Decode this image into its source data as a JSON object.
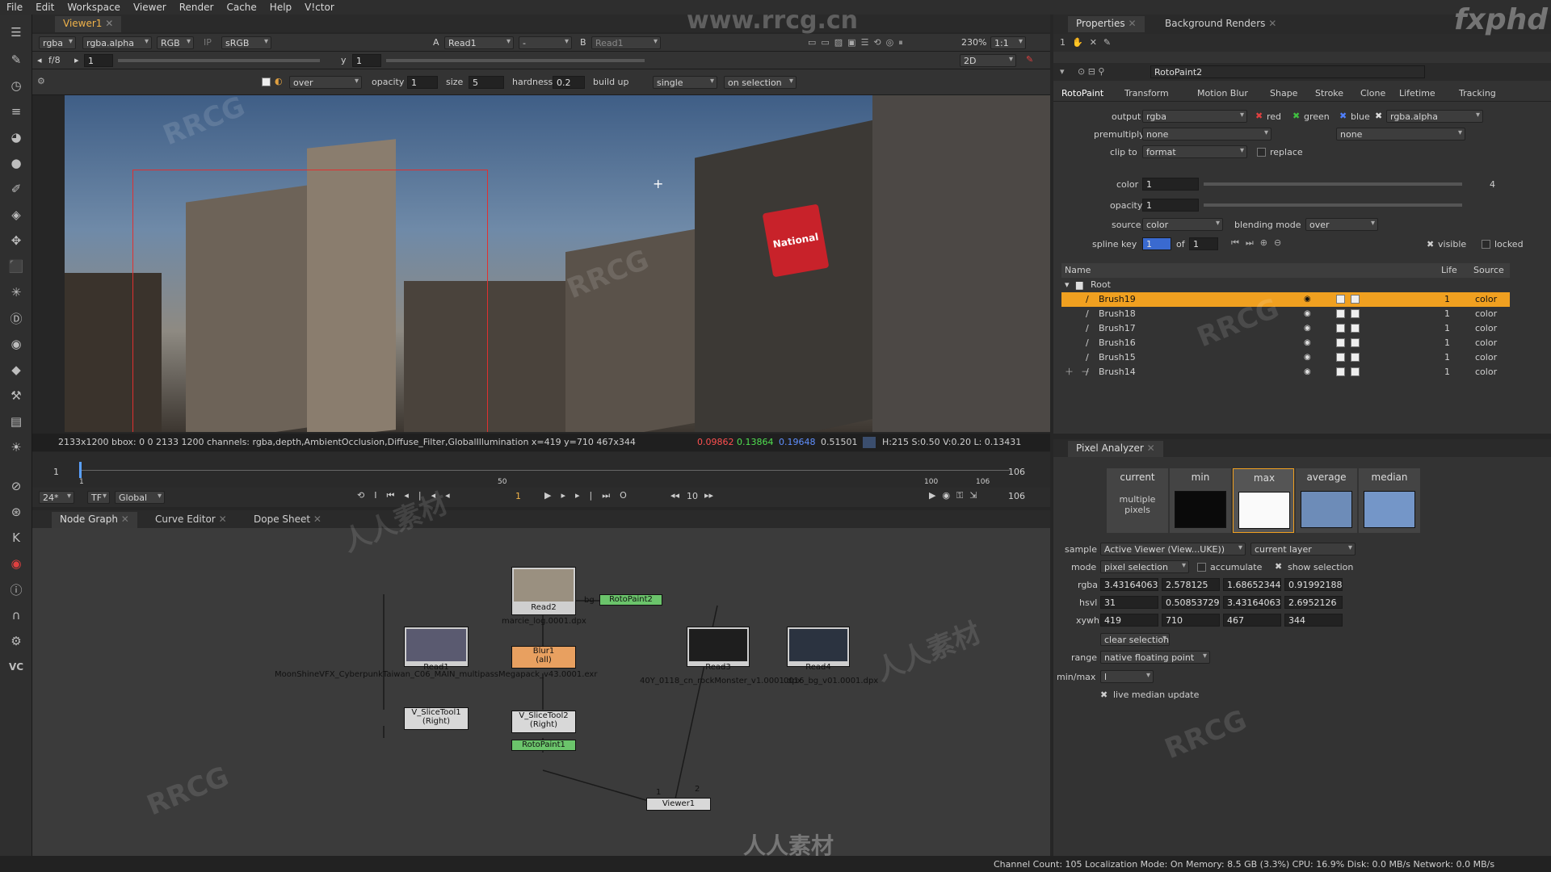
{
  "menu": [
    "File",
    "Edit",
    "Workspace",
    "Viewer",
    "Render",
    "Cache",
    "Help",
    "V!ctor"
  ],
  "viewer_tab": "Viewer1",
  "viewer_controls": {
    "channels": "rgba",
    "alpha": "rgba.alpha",
    "display": "RGB",
    "ip": "IP",
    "lut": "sRGB",
    "a_label": "A",
    "a_input": "Read1",
    "a_op": "-",
    "b_label": "B",
    "b_input": "Read1",
    "fstop": "f/8",
    "frame": "1",
    "y_label": "y",
    "y_value": "1",
    "zoom": "230%",
    "ratio": "1:1",
    "mode": "2D"
  },
  "paint_controls": {
    "blend": "over",
    "opacity_label": "opacity",
    "opacity": "1",
    "size_label": "size",
    "size": "5",
    "hardness_label": "hardness",
    "hardness": "0.2",
    "buildup": "build up",
    "single": "single",
    "on_selection": "on selection"
  },
  "viewport_sign": "National",
  "infobar": {
    "left": "2133x1200  bbox: 0 0 2133 1200 channels: rgba,depth,AmbientOcclusion,Diffuse_Filter,GlobalIllumination  x=419 y=710 467x344",
    "r": "0.09862",
    "g": "0.13864",
    "b": "0.19648",
    "a": "0.51501",
    "hsv": "H:215 S:0.50 V:0.20  L: 0.13431"
  },
  "timeline": {
    "start": "1",
    "end": "106",
    "current": "1",
    "ticks": [
      "1",
      "50",
      "100",
      "106"
    ],
    "fps": "24*",
    "tf": "TF",
    "global": "Global",
    "step": "10",
    "end_frame": "106"
  },
  "node_tabs": [
    "Node Graph",
    "Curve Editor",
    "Dope Sheet"
  ],
  "nodes": {
    "read2": "Read2",
    "read2_file": "marcie_log.0001.dpx",
    "roto2": "RotoPaint2",
    "bg": "bg",
    "read1": "Read1",
    "read1_file": "MoonShineVFX_CyberpunkTaiwan_C06_MAIN_multipassMegapack_v43.0001.exr",
    "blur1": "Blur1",
    "blur1_sub": "(all)",
    "read3": "Read3",
    "read3_file": "40Y_0118_cn_rockMonster_v1.0001.dpx",
    "read4": "Read4",
    "read4_file": "0016_bg_v01.0001.dpx",
    "slice1": "V_SliceTool1",
    "slice1_sub": "(Right)",
    "slice2": "V_SliceTool2",
    "slice2_sub": "(Right)",
    "roto1": "RotoPaint1",
    "viewer": "Viewer1",
    "vin1": "1",
    "vin2": "2"
  },
  "props_tabs": [
    "Properties",
    "Background Renders"
  ],
  "props": {
    "node_name": "RotoPaint2",
    "subtabs": [
      "RotoPaint",
      "Transform",
      "Motion Blur",
      "Shape",
      "Stroke",
      "Clone",
      "Lifetime",
      "Tracking"
    ],
    "output_label": "output",
    "output": "rgba",
    "red": "red",
    "green": "green",
    "blue": "blue",
    "alpha_ch": "rgba.alpha",
    "premult_label": "premultiply",
    "premult": "none",
    "premult2": "none",
    "clip_label": "clip to",
    "clip": "format",
    "replace": "replace",
    "color_label": "color",
    "color": "1",
    "color_count": "4",
    "opacity_label": "opacity",
    "opacity": "1",
    "source_label": "source",
    "source": "color",
    "blend_label": "blending mode",
    "blend": "over",
    "spline_label": "spline key",
    "spline": "1",
    "of_label": "of",
    "of": "1",
    "visible": "visible",
    "locked": "locked",
    "tree_headers": [
      "Name",
      "Life",
      "Source"
    ],
    "root": "Root",
    "brushes": [
      {
        "name": "Brush19",
        "life": "1",
        "source": "color"
      },
      {
        "name": "Brush18",
        "life": "1",
        "source": "color"
      },
      {
        "name": "Brush17",
        "life": "1",
        "source": "color"
      },
      {
        "name": "Brush16",
        "life": "1",
        "source": "color"
      },
      {
        "name": "Brush15",
        "life": "1",
        "source": "color"
      },
      {
        "name": "Brush14",
        "life": "1",
        "source": "color"
      }
    ]
  },
  "pa": {
    "tab": "Pixel Analyzer",
    "headers": [
      "current",
      "min",
      "max",
      "average",
      "median"
    ],
    "current_text": "multiple pixels",
    "sample_label": "sample",
    "sample": "Active Viewer (View...UKE))",
    "layer": "current layer",
    "mode_label": "mode",
    "mode": "pixel selection",
    "accumulate": "accumulate",
    "show_selection": "show selection",
    "rgba_label": "rgba",
    "rgba": [
      "3.43164063",
      "2.578125",
      "1.68652344",
      "0.91992188"
    ],
    "hsvl_label": "hsvl",
    "hsvl": [
      "31",
      "0.50853729",
      "3.43164063",
      "2.6952126"
    ],
    "xywh_label": "xywh",
    "xywh": [
      "419",
      "710",
      "467",
      "344"
    ],
    "clear": "clear selection",
    "range_label": "range",
    "range": "native floating point",
    "minmax_label": "min/max",
    "minmax": "l",
    "live": "live median update"
  },
  "status": "Channel Count: 105  Localization Mode: On  Memory: 8.5 GB (3.3%)  CPU: 16.9%  Disk: 0.0 MB/s  Network: 0.0 MB/s",
  "watermarks": [
    "www.rrcg.cn",
    "fxphd",
    "RRCG",
    "人人素材"
  ],
  "colors": {
    "accent": "#f0a020",
    "roto_node": "#6bc46b",
    "blur_node": "#e8a060",
    "selection": "#f0a020"
  }
}
